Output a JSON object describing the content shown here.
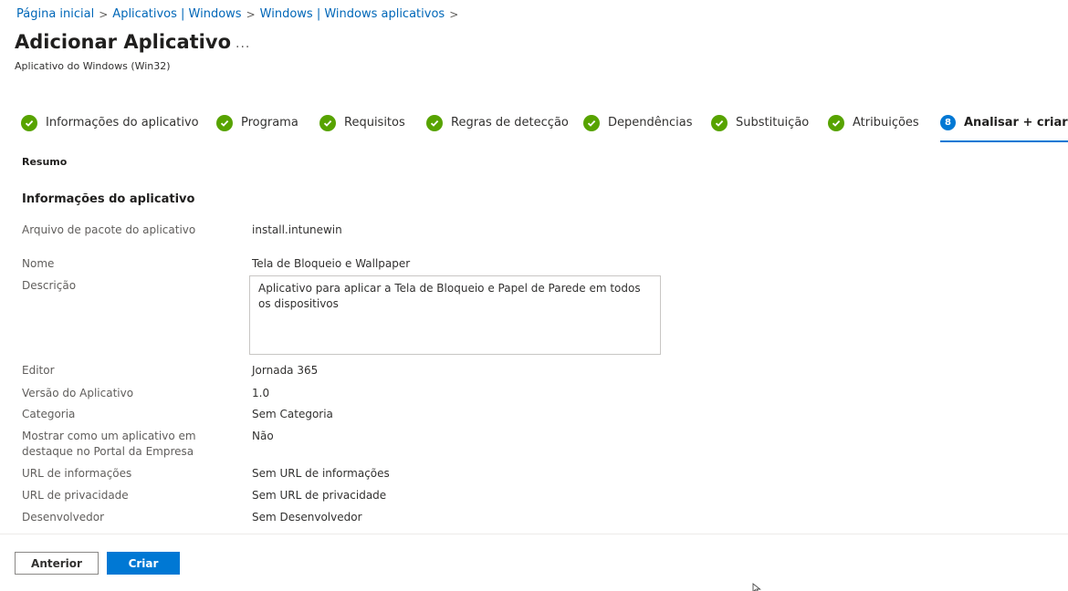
{
  "breadcrumb": {
    "items": [
      "Página inicial",
      "Aplicativos | Windows",
      "Windows | Windows aplicativos"
    ]
  },
  "header": {
    "title": "Adicionar Aplicativo",
    "more": "...",
    "subtitle": "Aplicativo do Windows (Win32)"
  },
  "steps": [
    {
      "label": "Informações do aplicativo",
      "state": "completed"
    },
    {
      "label": "Programa",
      "state": "completed"
    },
    {
      "label": "Requisitos",
      "state": "completed"
    },
    {
      "label": "Regras de detecção",
      "state": "completed"
    },
    {
      "label": "Dependências",
      "state": "completed"
    },
    {
      "label": "Substituição",
      "state": "completed"
    },
    {
      "label": "Atribuições",
      "state": "completed"
    },
    {
      "label": "Analisar + criar",
      "state": "active",
      "number": "8"
    }
  ],
  "summary": {
    "section_small": "Resumo",
    "section_title": "Informações do aplicativo",
    "fields": {
      "package_file": {
        "label": "Arquivo de pacote do aplicativo",
        "value": "install.intunewin"
      },
      "name": {
        "label": "Nome",
        "value": "Tela de Bloqueio e Wallpaper"
      },
      "description": {
        "label": "Descrição",
        "value": "Aplicativo para aplicar a Tela de Bloqueio e Papel de Parede em todos os dispositivos"
      },
      "publisher": {
        "label": "Editor",
        "value": "Jornada 365"
      },
      "version": {
        "label": "Versão do Aplicativo",
        "value": "1.0"
      },
      "category": {
        "label": "Categoria",
        "value": "Sem Categoria"
      },
      "featured": {
        "label": "Mostrar como um aplicativo em destaque no Portal da Empresa",
        "value": "Não"
      },
      "info_url": {
        "label": "URL de informações",
        "value": "Sem URL de informações"
      },
      "privacy_url": {
        "label": "URL de privacidade",
        "value": "Sem URL de privacidade"
      },
      "developer": {
        "label": "Desenvolvedor",
        "value": "Sem Desenvolvedor"
      }
    }
  },
  "footer": {
    "previous_label": "Anterior",
    "create_label": "Criar"
  },
  "colors": {
    "accent": "#0078d4",
    "success": "#57a300",
    "link": "#0067b8"
  }
}
